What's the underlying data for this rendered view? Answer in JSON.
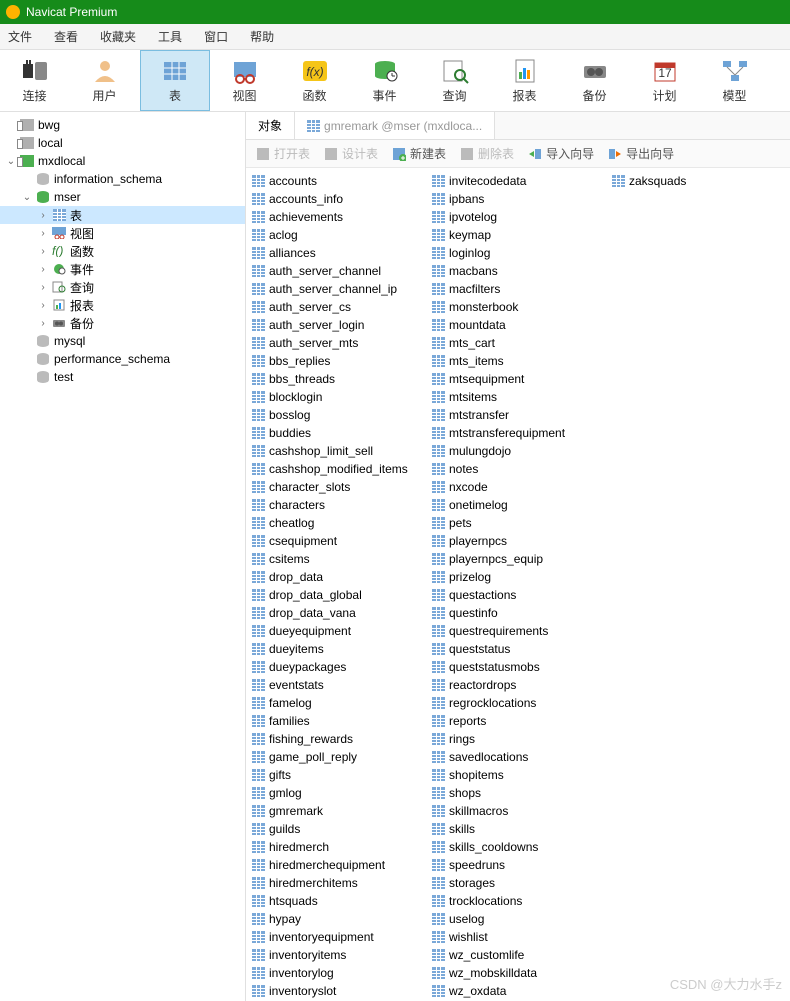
{
  "title": "Navicat Premium",
  "menu": [
    "文件",
    "查看",
    "收藏夹",
    "工具",
    "窗口",
    "帮助"
  ],
  "toolbar": [
    {
      "label": "连接",
      "icon": "plug"
    },
    {
      "label": "用户",
      "icon": "user"
    },
    {
      "label": "表",
      "icon": "table",
      "active": true
    },
    {
      "label": "视图",
      "icon": "view"
    },
    {
      "label": "函数",
      "icon": "fx"
    },
    {
      "label": "事件",
      "icon": "event"
    },
    {
      "label": "查询",
      "icon": "query"
    },
    {
      "label": "报表",
      "icon": "report"
    },
    {
      "label": "备份",
      "icon": "backup"
    },
    {
      "label": "计划",
      "icon": "plan"
    },
    {
      "label": "模型",
      "icon": "model"
    }
  ],
  "tree": {
    "connections": [
      {
        "name": "bwg",
        "open": false
      },
      {
        "name": "local",
        "open": false
      },
      {
        "name": "mxdlocal",
        "open": true,
        "databases": [
          {
            "name": "information_schema",
            "open": false
          },
          {
            "name": "mser",
            "open": true,
            "selected_child": "表",
            "children": [
              {
                "name": "表",
                "icon": "table",
                "selected": true
              },
              {
                "name": "视图",
                "icon": "view"
              },
              {
                "name": "函数",
                "icon": "fx"
              },
              {
                "name": "事件",
                "icon": "event"
              },
              {
                "name": "查询",
                "icon": "query"
              },
              {
                "name": "报表",
                "icon": "report"
              },
              {
                "name": "备份",
                "icon": "backup"
              }
            ]
          },
          {
            "name": "mysql",
            "open": false
          },
          {
            "name": "performance_schema",
            "open": false
          },
          {
            "name": "test",
            "open": false
          }
        ]
      }
    ]
  },
  "tabs": [
    {
      "label": "对象",
      "active": true
    },
    {
      "label": "gmremark @mser (mxdloca...",
      "active": false
    }
  ],
  "actions": [
    {
      "label": "打开表",
      "disabled": true,
      "color": "#bbb"
    },
    {
      "label": "设计表",
      "disabled": true,
      "color": "#bbb"
    },
    {
      "label": "新建表",
      "color": "#2e7d32",
      "icon": "plus"
    },
    {
      "label": "删除表",
      "disabled": true,
      "color": "#bbb"
    },
    {
      "label": "导入向导",
      "color": "#2e7d32",
      "icon": "import"
    },
    {
      "label": "导出向导",
      "color": "#ef6c00",
      "icon": "export"
    }
  ],
  "tables_col1": [
    "accounts",
    "accounts_info",
    "achievements",
    "aclog",
    "alliances",
    "auth_server_channel",
    "auth_server_channel_ip",
    "auth_server_cs",
    "auth_server_login",
    "auth_server_mts",
    "bbs_replies",
    "bbs_threads",
    "blocklogin",
    "bosslog",
    "buddies",
    "cashshop_limit_sell",
    "cashshop_modified_items",
    "character_slots",
    "characters",
    "cheatlog",
    "csequipment",
    "csitems",
    "drop_data",
    "drop_data_global",
    "drop_data_vana",
    "dueyequipment",
    "dueyitems",
    "dueypackages",
    "eventstats",
    "famelog",
    "families",
    "fishing_rewards",
    "game_poll_reply",
    "gifts",
    "gmlog",
    "gmremark",
    "guilds",
    "hiredmerch",
    "hiredmerchequipment",
    "hiredmerchitems",
    "htsquads",
    "hypay",
    "inventoryequipment",
    "inventoryitems",
    "inventorylog",
    "inventoryslot"
  ],
  "tables_col2": [
    "invitecodedata",
    "ipbans",
    "ipvotelog",
    "keymap",
    "loginlog",
    "macbans",
    "macfilters",
    "monsterbook",
    "mountdata",
    "mts_cart",
    "mts_items",
    "mtsequipment",
    "mtsitems",
    "mtstransfer",
    "mtstransferequipment",
    "mulungdojo",
    "notes",
    "nxcode",
    "onetimelog",
    "pets",
    "playernpcs",
    "playernpcs_equip",
    "prizelog",
    "questactions",
    "questinfo",
    "questrequirements",
    "queststatus",
    "queststatusmobs",
    "reactordrops",
    "regrocklocations",
    "reports",
    "rings",
    "savedlocations",
    "shopitems",
    "shops",
    "skillmacros",
    "skills",
    "skills_cooldowns",
    "speedruns",
    "storages",
    "trocklocations",
    "uselog",
    "wishlist",
    "wz_customlife",
    "wz_mobskilldata",
    "wz_oxdata"
  ],
  "tables_col3": [
    "zaksquads"
  ],
  "watermark": "CSDN @大力水手z"
}
